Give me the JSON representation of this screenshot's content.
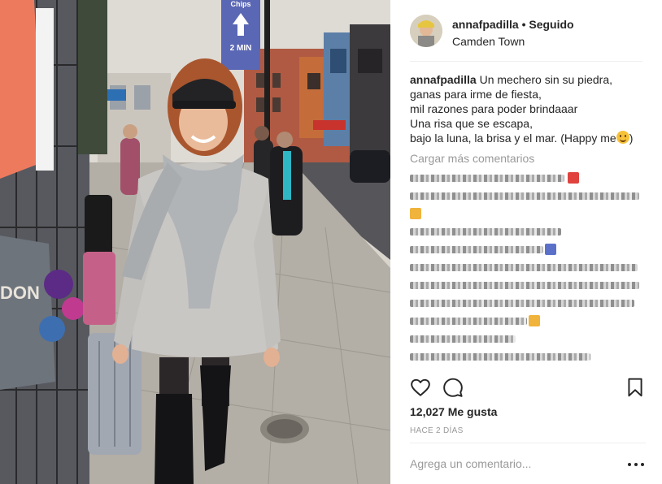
{
  "post": {
    "username": "annafpadilla",
    "separator": "•",
    "follow_status": "Seguido",
    "location": "Camden Town"
  },
  "caption": {
    "username": "annafpadilla",
    "lines": [
      "Un mechero sin su piedra,",
      "ganas para irme de fiesta,",
      "mil razones para poder brindaaar",
      "Una risa que se escapa,",
      "bajo la luna, la brisa y el mar. (Happy me"
    ],
    "emoji": "smiling-face-icon"
  },
  "comments": {
    "load_more": "Cargar más comentarios",
    "pixelated_rows": 10
  },
  "photo": {
    "sign_text_top": "Chips",
    "sign_text_mid": "2 MIN"
  },
  "actions": {
    "like_icon": "heart-icon",
    "comment_icon": "comment-icon",
    "save_icon": "bookmark-icon"
  },
  "likes": "12,027 Me gusta",
  "time_ago": "HACE 2 DÍAS",
  "add_comment": {
    "placeholder": "Agrega un comentario...",
    "more_icon": "more-options-icon"
  },
  "colors": {
    "text": "#262626",
    "muted": "#999999",
    "divider": "#efefef"
  }
}
